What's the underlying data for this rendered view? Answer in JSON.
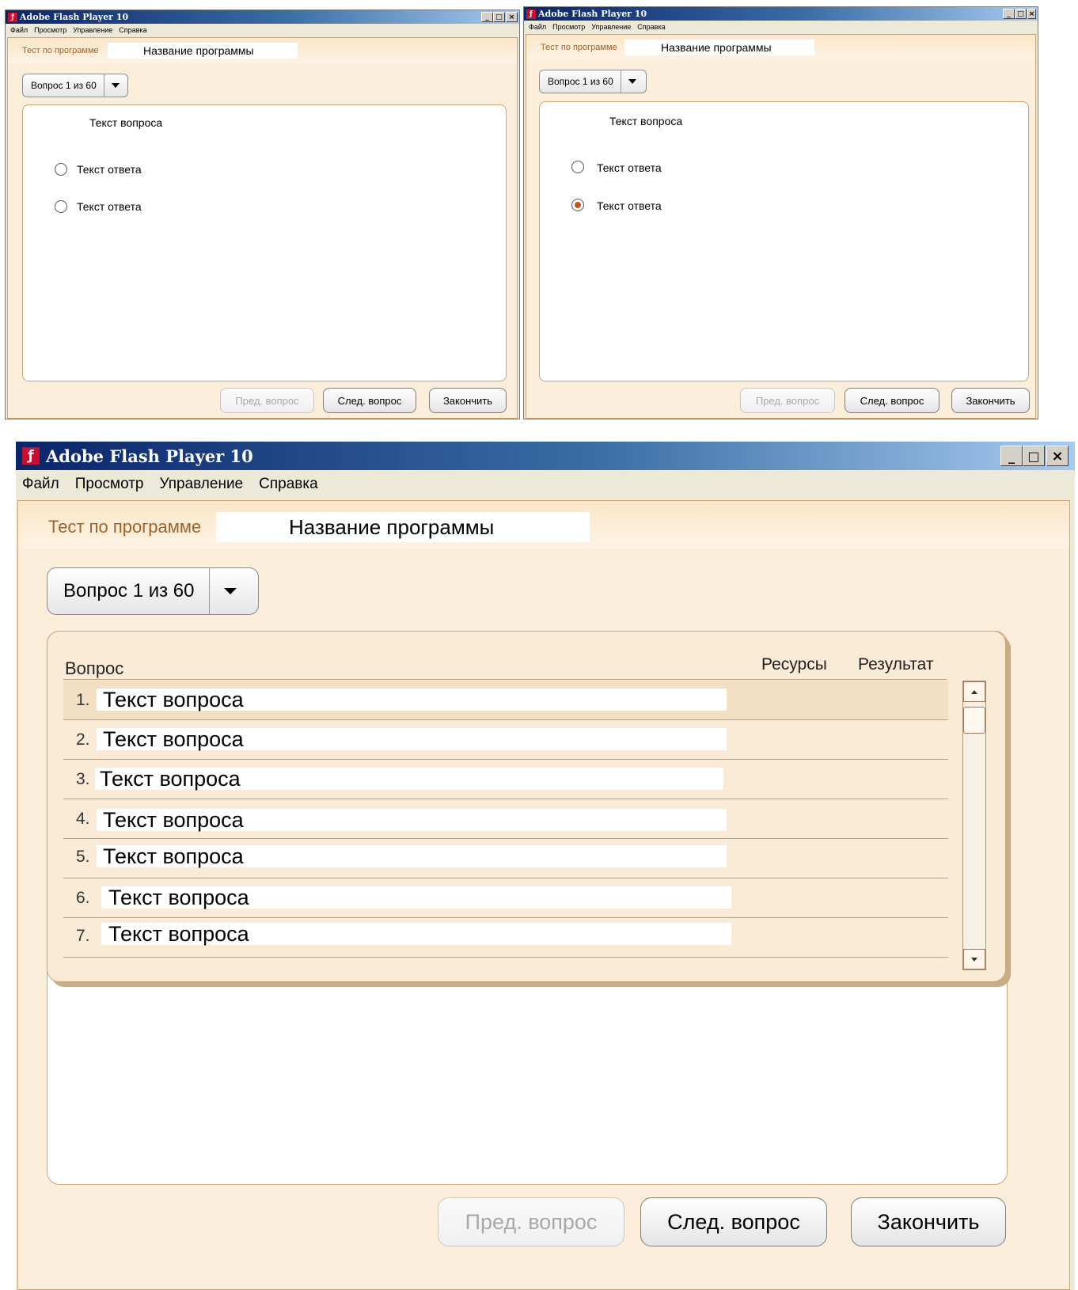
{
  "app": {
    "window_title": "Adobe Flash Player 10",
    "menu": [
      "Файл",
      "Просмотр",
      "Управление",
      "Справка"
    ]
  },
  "header": {
    "test_label": "Тест по программе",
    "program_name": "Название программы"
  },
  "question_selector": {
    "label": "Вопрос 1 из 60"
  },
  "question": {
    "text": "Текст вопроса",
    "answers": [
      "Текст ответа",
      "Текст ответа"
    ]
  },
  "screen_left": {
    "selected_answer": null
  },
  "screen_right": {
    "selected_answer": 2
  },
  "question_list": {
    "col_question": "Вопрос",
    "col_resources": "Ресурсы",
    "col_result": "Результат",
    "rows": [
      {
        "num": "1.",
        "text": "Текст вопроса",
        "selected": true
      },
      {
        "num": "2.",
        "text": "Текст вопроса",
        "selected": false
      },
      {
        "num": "3.",
        "text": "Текст вопроса",
        "selected": false
      },
      {
        "num": "4.",
        "text": "Текст вопроса",
        "selected": false
      },
      {
        "num": "5.",
        "text": "Текст вопроса",
        "selected": false
      },
      {
        "num": "6.",
        "text": "Текст вопроса",
        "selected": false
      },
      {
        "num": "7.",
        "text": "Текст вопроса",
        "selected": false
      }
    ]
  },
  "buttons": {
    "prev": "Пред. вопрос",
    "next": "След. вопрос",
    "finish": "Закончить"
  },
  "icons": [
    "flash-icon",
    "minimize-icon",
    "maximize-icon",
    "close-icon",
    "dropdown-caret-icon",
    "scroll-up-icon",
    "scroll-down-icon"
  ],
  "colors": {
    "accent": "#a0622b",
    "panel_border": "#c9a57a",
    "selected_radio": "#c0552c"
  }
}
